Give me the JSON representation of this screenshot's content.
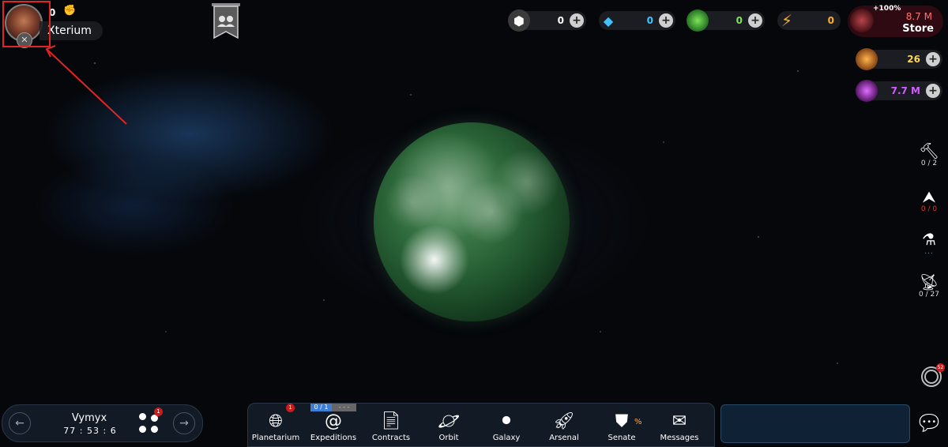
{
  "player": {
    "name": "Xterium",
    "count": "0"
  },
  "resources": [
    {
      "icon": "metal-icon",
      "value": "0",
      "color": "#ffffff"
    },
    {
      "icon": "crystal-icon",
      "value": "0",
      "color": "#3fc3ff"
    },
    {
      "icon": "deuterium-icon",
      "value": "0",
      "color": "#7ee35a"
    },
    {
      "icon": "energy-icon",
      "value": "0",
      "color": "#ffb020"
    }
  ],
  "store": {
    "bonus": "+100%",
    "amount": "8.7 M",
    "label": "Store"
  },
  "currencies": [
    {
      "icon": "gold-icon",
      "value": "26",
      "color": "#ffd84a"
    },
    {
      "icon": "dark-matter-icon",
      "value": "7.7 M",
      "color": "#d35cff"
    }
  ],
  "right_stats": [
    {
      "icon": "hammer-icon",
      "text": "0 / 2"
    },
    {
      "icon": "ship-icon",
      "text": "0 / 0"
    },
    {
      "icon": "research-icon",
      "text": "..."
    },
    {
      "icon": "satellite-dish-icon",
      "text": "0 / 27"
    }
  ],
  "support": {
    "badge": "52"
  },
  "planet_switcher": {
    "name": "Vymyx",
    "time": "77 : 53 : 6",
    "badge": "1"
  },
  "nav": {
    "expedition_bar": {
      "slots": "0 / 1",
      "timer": "- - -"
    },
    "items": [
      {
        "label": "Planetarium",
        "badge": "1"
      },
      {
        "label": "Expeditions"
      },
      {
        "label": "Contracts"
      },
      {
        "label": "Orbit"
      },
      {
        "label": "Galaxy"
      },
      {
        "label": "Arsenal"
      },
      {
        "label": "Senate",
        "extra": "%"
      },
      {
        "label": "Messages"
      }
    ]
  }
}
